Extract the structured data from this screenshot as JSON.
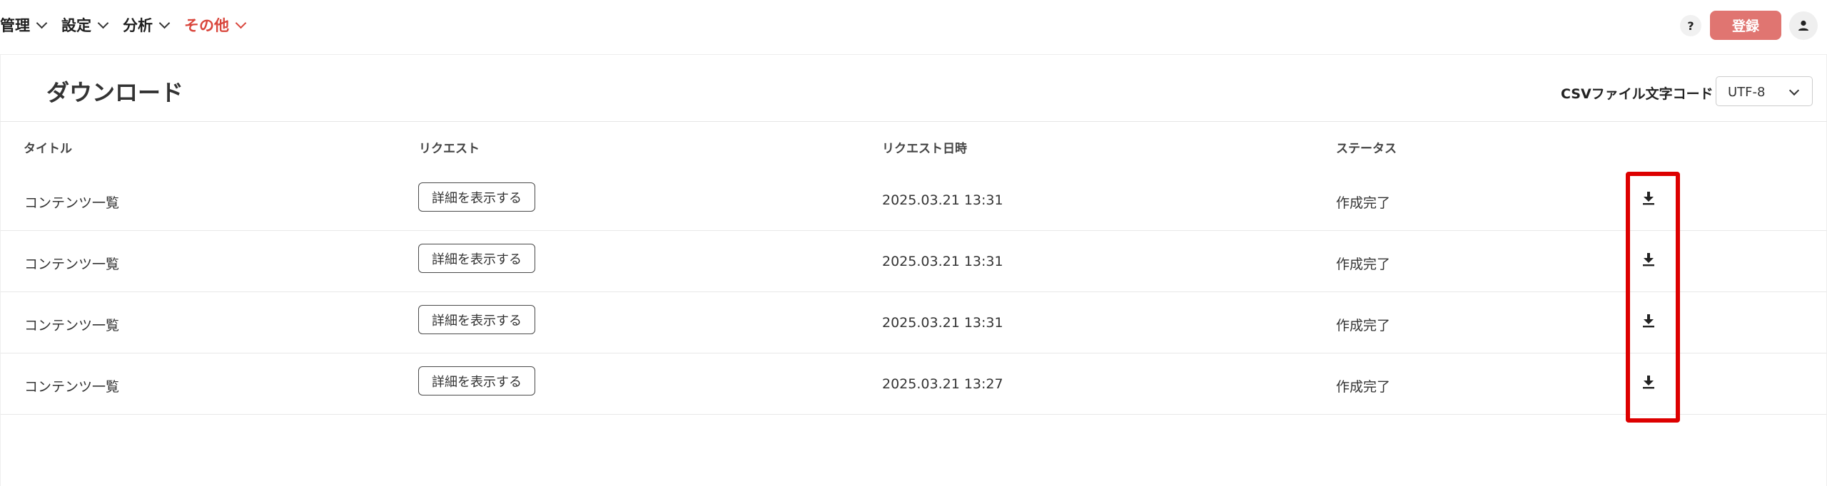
{
  "nav": {
    "items": [
      {
        "label": "管理",
        "active": false
      },
      {
        "label": "設定",
        "active": false
      },
      {
        "label": "分析",
        "active": false
      },
      {
        "label": "その他",
        "active": true
      }
    ],
    "help_label": "?",
    "register_label": "登録",
    "accent_color": "#d9453b"
  },
  "page": {
    "title": "ダウンロード",
    "encoding_label": "CSVファイル文字コード",
    "encoding_value": "UTF-8"
  },
  "table": {
    "headers": {
      "title": "タイトル",
      "request": "リクエスト",
      "date": "リクエスト日時",
      "status": "ステータス"
    },
    "rows": [
      {
        "title": "コンテンツ一覧",
        "detail_label": "詳細を表示する",
        "date": "2025.03.21 13:31",
        "status": "作成完了"
      },
      {
        "title": "コンテンツ一覧",
        "detail_label": "詳細を表示する",
        "date": "2025.03.21 13:31",
        "status": "作成完了"
      },
      {
        "title": "コンテンツ一覧",
        "detail_label": "詳細を表示する",
        "date": "2025.03.21 13:31",
        "status": "作成完了"
      },
      {
        "title": "コンテンツ一覧",
        "detail_label": "詳細を表示する",
        "date": "2025.03.21 13:27",
        "status": "作成完了"
      }
    ]
  },
  "icons": {
    "download": "download-icon",
    "user": "user-icon",
    "chevron": "chevron-down-icon"
  },
  "highlight_color": "#dd0000"
}
